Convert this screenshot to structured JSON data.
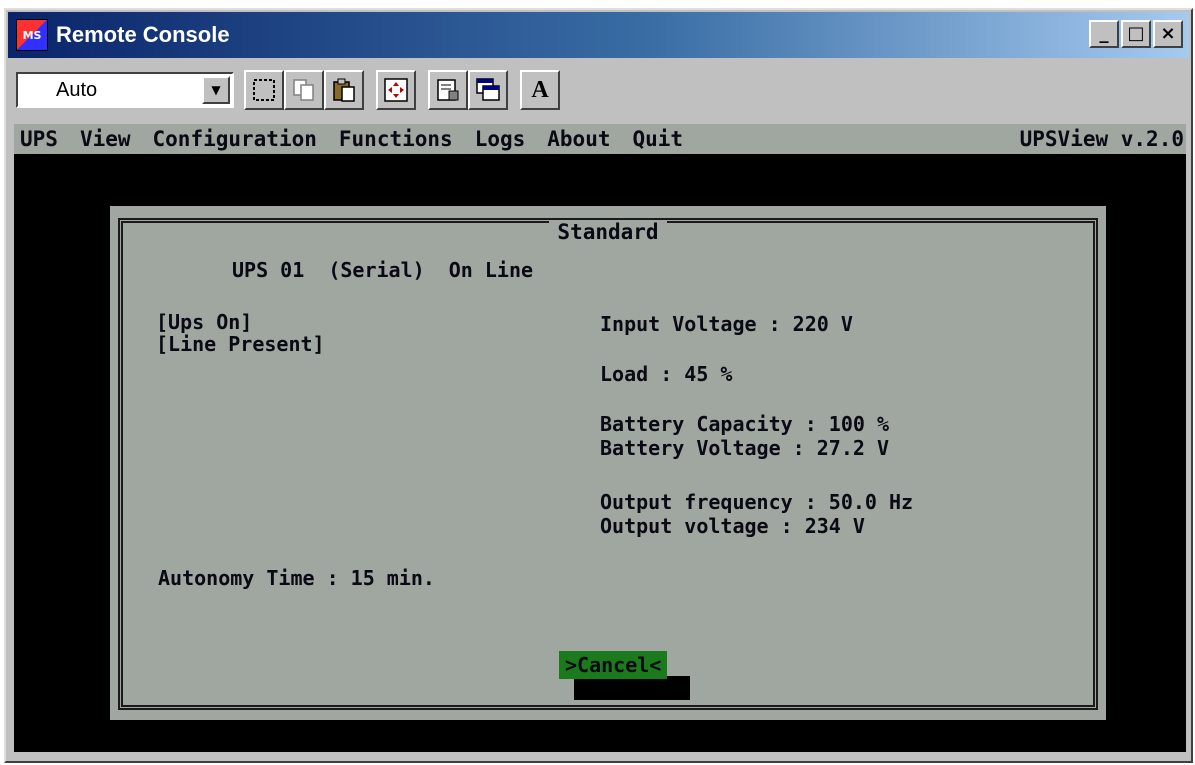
{
  "window": {
    "title": "Remote Console",
    "icon_label": "MS",
    "controls": {
      "minimize": "_",
      "maximize": "□",
      "close": "×"
    }
  },
  "toolbar": {
    "mode_select": {
      "value": "Auto",
      "dropdown_glyph": "▼"
    },
    "icons": [
      "mark-icon",
      "copy-icon",
      "paste-icon",
      "fullscreen-icon",
      "properties-icon",
      "background-icon",
      "font-icon"
    ],
    "font_button_label": "A"
  },
  "menubar": {
    "items": [
      "UPS",
      "View",
      "Configuration",
      "Functions",
      "Logs",
      "About",
      "Quit"
    ],
    "version": "UPSView v.2.0"
  },
  "dialog": {
    "title": "Standard",
    "ups_header": "UPS 01  (Serial)  On Line",
    "status_lines": [
      "[Ups On]",
      "[Line Present]"
    ],
    "input_voltage": "Input Voltage : 220 V",
    "load": "Load : 45 %",
    "battery_capacity": "Battery Capacity : 100 %",
    "battery_voltage": "Battery Voltage : 27.2 V",
    "output_frequency": "Output frequency : 50.0 Hz",
    "output_voltage": "Output voltage : 234 V",
    "autonomy": "Autonomy Time : 15 min.",
    "cancel_label": ">Cancel<"
  },
  "colors": {
    "title_gradient_start": "#0a246a",
    "title_gradient_end": "#a6caf0",
    "console_background": "#000000",
    "dialog_background": "#a0a6a0",
    "cancel_highlight": "#1b7a1b"
  }
}
